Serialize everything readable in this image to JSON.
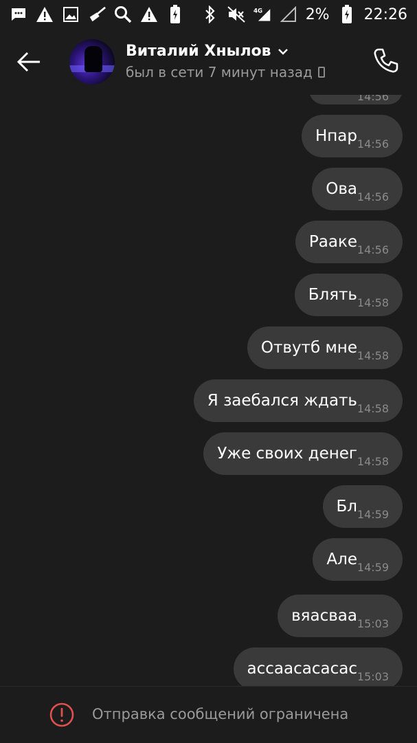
{
  "status_bar": {
    "battery_percent": "2%",
    "time": "22:26",
    "network": "4G",
    "icons_left": [
      "messages-icon",
      "warning-icon",
      "gallery-icon",
      "cleaner-icon",
      "search-icon",
      "warning-icon",
      "battery-saver-icon"
    ],
    "icons_right": [
      "bluetooth-icon",
      "mute-icon",
      "signal-icon",
      "no-signal-icon",
      "battery-charging-icon"
    ]
  },
  "header": {
    "contact_name": "Виталий Хнылов",
    "last_seen": "был в сети 7 минут назад"
  },
  "messages": [
    {
      "text": "",
      "time": "14:56",
      "partial": true
    },
    {
      "text": "Нпар",
      "time": "14:56"
    },
    {
      "text": "Ова",
      "time": "14:56"
    },
    {
      "text": "Рааке",
      "time": "14:56"
    },
    {
      "text": "Блять",
      "time": "14:58"
    },
    {
      "text": "Отвутб мне",
      "time": "14:58"
    },
    {
      "text": "Я заебался ждать",
      "time": "14:58"
    },
    {
      "text": "Уже своих денег",
      "time": "14:58"
    },
    {
      "text": "Бл",
      "time": "14:59"
    },
    {
      "text": "Але",
      "time": "14:59"
    },
    {
      "text": "вяасваа",
      "time": "15:03"
    },
    {
      "text": "ассаасасасас",
      "time": "15:03"
    }
  ],
  "footer": {
    "restriction_text": "Отправка сообщений ограничена"
  },
  "colors": {
    "background": "#1c1c1c",
    "bubble": "#3a3a3a",
    "secondary_text": "#9a9a9a",
    "warning_red": "#e0504f"
  }
}
